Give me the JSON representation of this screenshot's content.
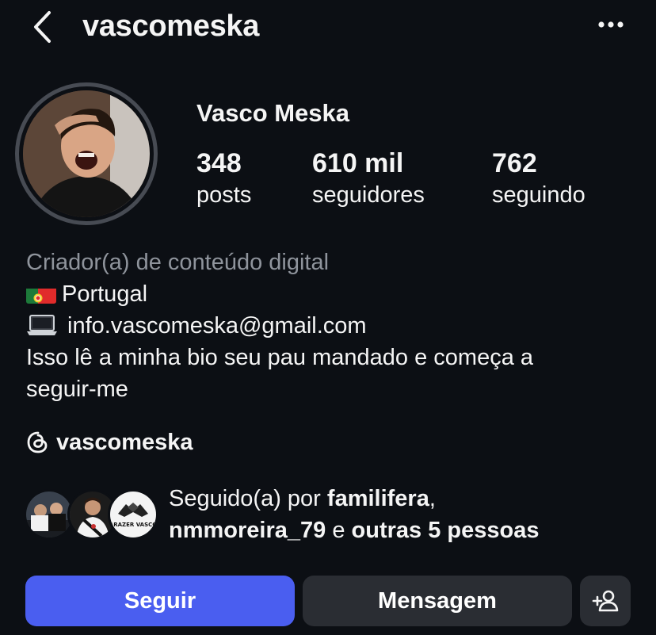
{
  "header": {
    "username": "vascomeska"
  },
  "profile": {
    "full_name": "Vasco Meska",
    "stats": [
      {
        "value": "348",
        "label": "posts"
      },
      {
        "value": "610 mil",
        "label": "seguidores"
      },
      {
        "value": "762",
        "label": "seguindo"
      }
    ],
    "category": "Criador(a) de conteúdo digital",
    "bio": {
      "location": "Portugal",
      "email": "info.vascomeska@gmail.com",
      "line1": "Isso lê a minha bio seu pau mandado e começa a",
      "line2": "seguir-me"
    },
    "threads_handle": "vascomeska"
  },
  "followed_by": {
    "prefix": "Seguido(a) por",
    "name1": "familifera",
    "name2": "nmmoreira_79",
    "connector": "e",
    "others": "outras 5 pessoas",
    "avatar3_text": "ARAZER VASCO"
  },
  "actions": {
    "follow_label": "Seguir",
    "message_label": "Mensagem"
  },
  "colors": {
    "background": "#0c0f14",
    "follow_button": "#4a5ef0",
    "secondary_button": "#2a2d33",
    "muted_text": "#8f949c"
  }
}
